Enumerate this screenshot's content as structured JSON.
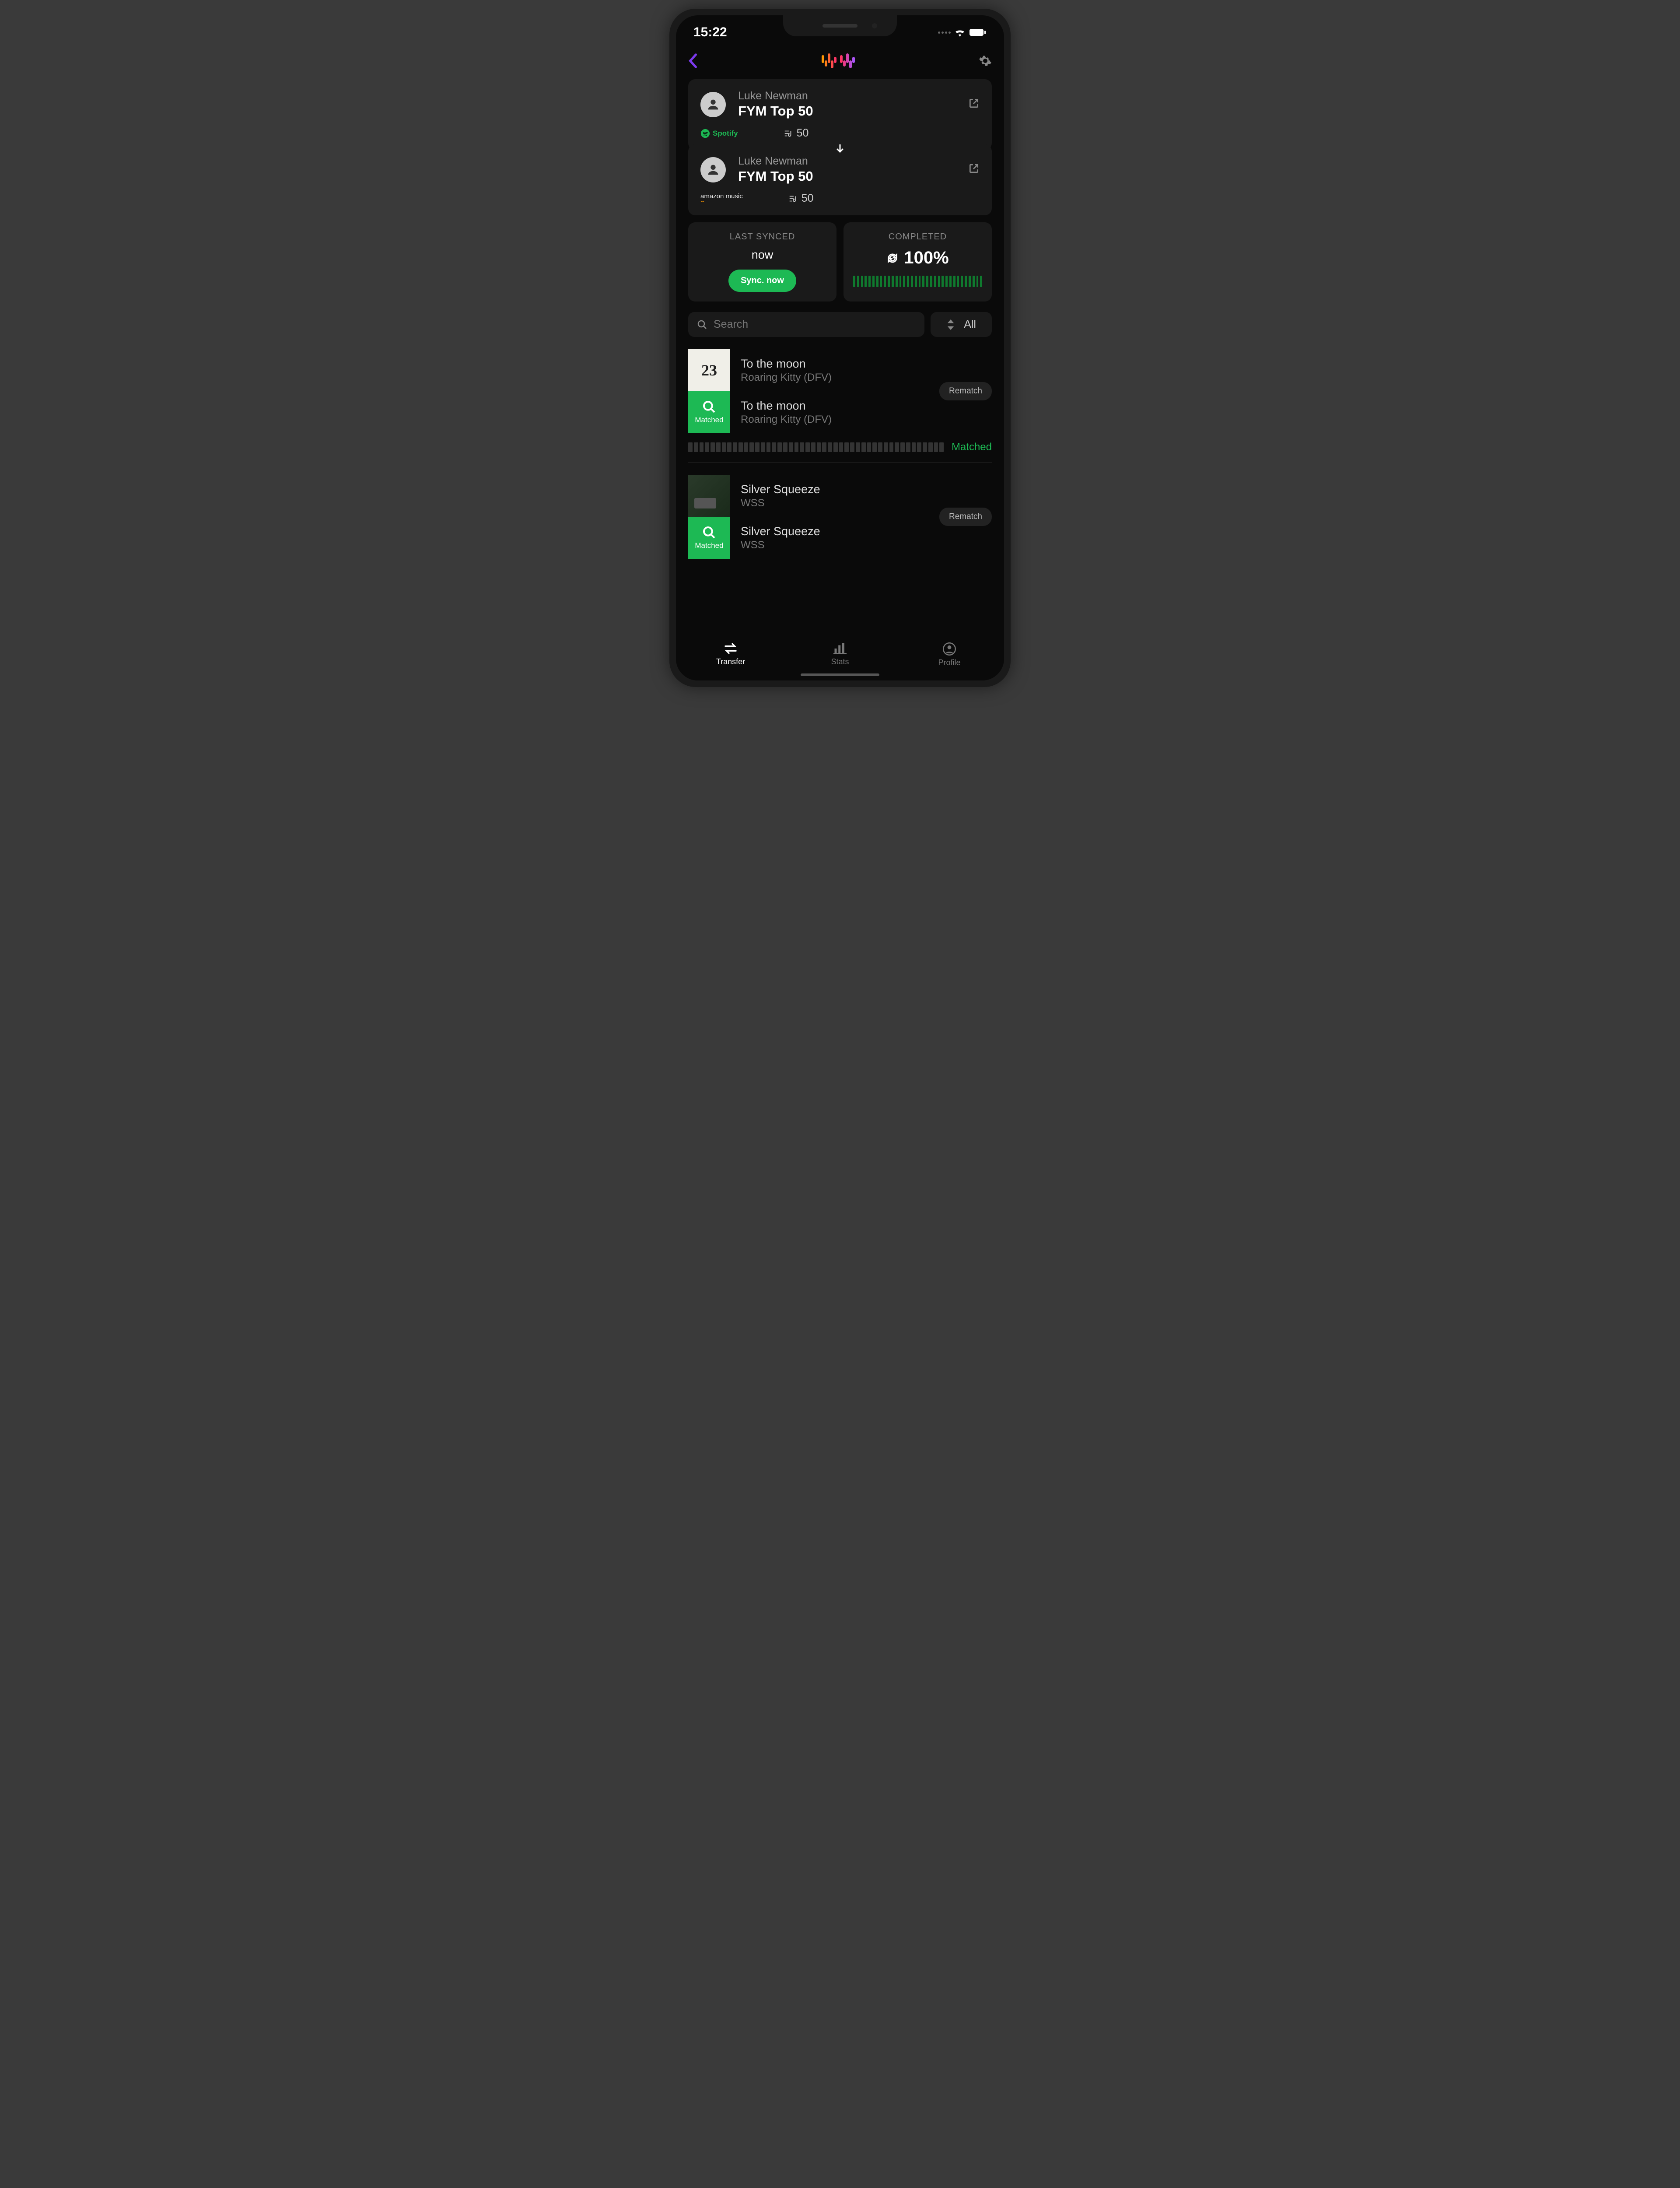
{
  "status": {
    "time": "15:22"
  },
  "source": {
    "owner": "Luke Newman",
    "title": "FYM Top 50",
    "service": "Spotify",
    "track_count": "50"
  },
  "destination": {
    "owner": "Luke Newman",
    "title": "FYM Top 50",
    "service": "amazon music",
    "track_count": "50"
  },
  "last_synced": {
    "label": "LAST SYNCED",
    "value": "now",
    "button": "Sync. now"
  },
  "completed": {
    "label": "COMPLETED",
    "value": "100%"
  },
  "search": {
    "placeholder": "Search"
  },
  "filter": {
    "label": "All"
  },
  "tracks": [
    {
      "source": {
        "title": "To the moon",
        "artist": "Roaring Kitty (DFV)",
        "art_text": "23"
      },
      "match": {
        "title": "To the moon",
        "artist": "Roaring Kitty (DFV)",
        "badge": "Matched"
      },
      "rematch": "Rematch",
      "status": "Matched"
    },
    {
      "source": {
        "title": "Silver Squeeze",
        "artist": "WSS"
      },
      "match": {
        "title": "Silver Squeeze",
        "artist": "WSS",
        "badge": "Matched"
      },
      "rematch": "Rematch"
    }
  ],
  "nav": {
    "transfer": "Transfer",
    "stats": "Stats",
    "profile": "Profile"
  }
}
